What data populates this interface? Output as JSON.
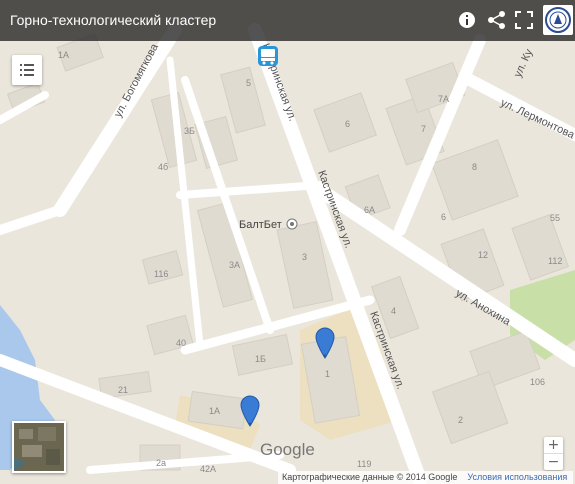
{
  "header": {
    "title": "Горно-технологический кластер",
    "icons": [
      "info-icon",
      "share-icon",
      "fullscreen-icon"
    ]
  },
  "map": {
    "streets": [
      "ул. Богомягкова",
      "Кастринская ул.",
      "Кастринская ул.",
      "Кастринская ул.",
      "ул. Анохина",
      "ул. Лермонтова",
      "ул. Ку"
    ],
    "poi": "БалтБет",
    "buildings": [
      "1А",
      "5",
      "3Б",
      "4б",
      "6",
      "7А",
      "7",
      "8",
      "6А",
      "6",
      "55",
      "3",
      "3А",
      "12",
      "116",
      "112",
      "40",
      "1Б",
      "4",
      "1",
      "21",
      "106",
      "1А",
      "2",
      "2а",
      "42А",
      "119"
    ],
    "markers": [
      "marker-1",
      "marker-2"
    ],
    "colors": {
      "background": "#ebe6dc",
      "road": "#ffffff",
      "building": "#e0dbd0",
      "water": "#a9c8ec",
      "park": "#c8dfa8",
      "campus": "#ece0c1",
      "pin": "#3a7bd5"
    }
  },
  "watermark": "Google",
  "attribution": {
    "text": "Картографические данные © 2014 Google",
    "terms": "Условия использования"
  },
  "zoom": {
    "in": "+",
    "out": "−"
  }
}
